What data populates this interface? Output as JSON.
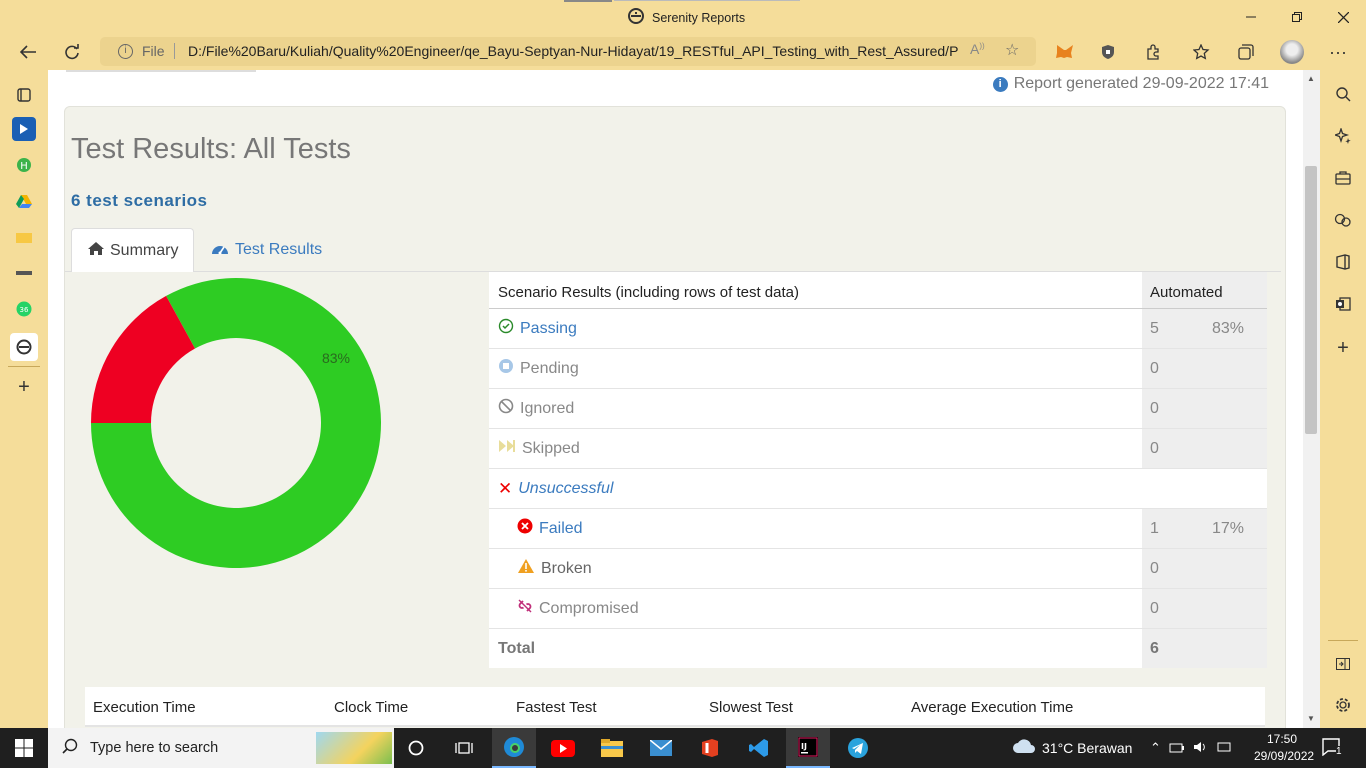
{
  "window": {
    "title": "Serenity Reports"
  },
  "browser": {
    "url_prefix": "File",
    "url": "D:/File%20Baru/Kuliah/Quality%20Engineer/qe_Bayu-Septyan-Nur-Hidayat/19_RESTful_API_Testing_with_Rest_Assured/Prak..."
  },
  "report": {
    "generated": "Report generated 29-09-2022 17:41",
    "title": "Test Results: All Tests",
    "scenario_count": "6 test scenarios",
    "tabs": [
      {
        "label": "Summary",
        "icon": "home-icon"
      },
      {
        "label": "Test Results",
        "icon": "dashboard-icon"
      }
    ]
  },
  "chart_data": {
    "type": "pie",
    "categories": [
      "Passing",
      "Failed"
    ],
    "values": [
      83,
      17
    ],
    "labels": [
      "83%",
      "17%"
    ],
    "colors": [
      "#2ecc23",
      "#ee0022"
    ]
  },
  "table": {
    "header": {
      "label": "Scenario Results (including rows of test data)",
      "col": "Automated"
    },
    "rows": [
      {
        "label": "Passing",
        "count": "5",
        "pct": "83%"
      },
      {
        "label": "Pending",
        "count": "0",
        "pct": ""
      },
      {
        "label": "Ignored",
        "count": "0",
        "pct": ""
      },
      {
        "label": "Skipped",
        "count": "0",
        "pct": ""
      },
      {
        "label": "Unsuccessful",
        "count": "",
        "pct": ""
      },
      {
        "label": "Failed",
        "count": "1",
        "pct": "17%"
      },
      {
        "label": "Broken",
        "count": "0",
        "pct": ""
      },
      {
        "label": "Compromised",
        "count": "0",
        "pct": ""
      },
      {
        "label": "Total",
        "count": "6",
        "pct": ""
      }
    ]
  },
  "stats": {
    "headers": [
      "Execution Time",
      "Clock Time",
      "Fastest Test",
      "Slowest Test",
      "Average Execution Time"
    ]
  },
  "taskbar": {
    "search_placeholder": "Type here to search",
    "weather": "31°C  Berawan",
    "time": "17:50",
    "date": "29/09/2022",
    "notifications": "1"
  }
}
